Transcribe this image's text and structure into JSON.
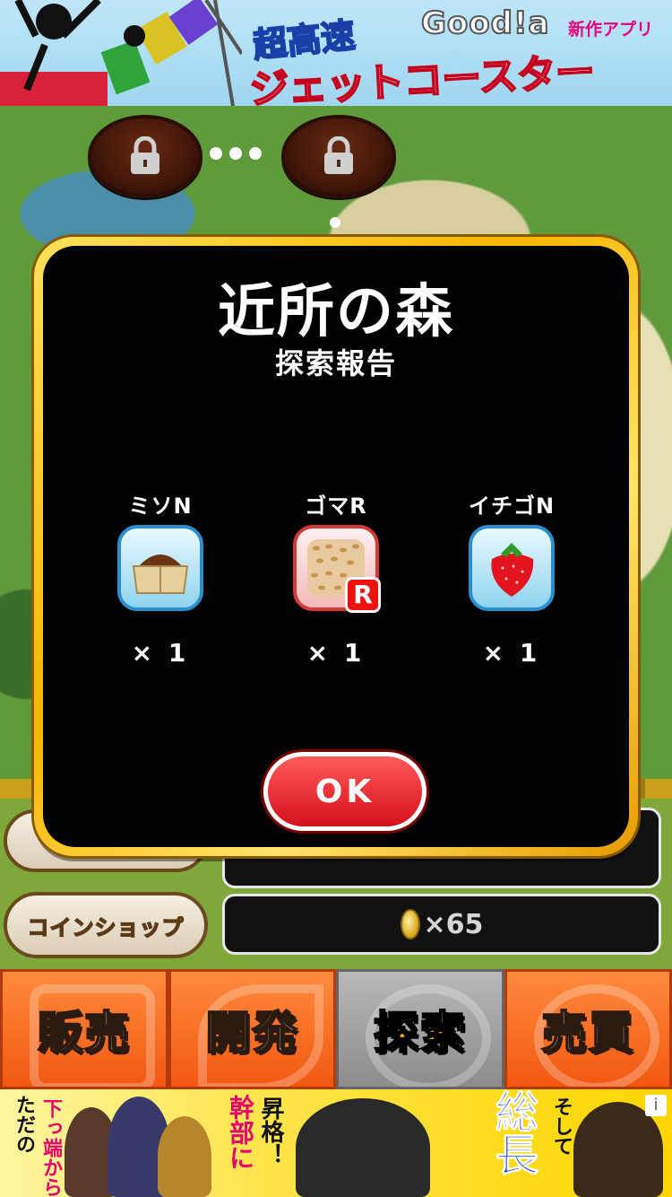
{
  "top_ad": {
    "title_line1": "超高速",
    "title_line2": "ジェットコースター",
    "brand": "Good!a",
    "tag": "新作アプリ"
  },
  "map": {
    "locks": [
      "lock-icon",
      "lock-icon"
    ]
  },
  "dialog": {
    "title": "近所の森",
    "subtitle": "探索報告",
    "items": [
      {
        "name": "ミソN",
        "icon": "miso-icon",
        "count": "× 1",
        "rare": false
      },
      {
        "name": "ゴマR",
        "icon": "sesame-icon",
        "count": "× 1",
        "rare": true,
        "badge": "R"
      },
      {
        "name": "イチゴN",
        "icon": "strawberry-icon",
        "count": "× 1",
        "rare": false
      }
    ],
    "ok_label": "OK"
  },
  "panel": {
    "coin_shop_label": "コインショップ",
    "coin_count": "×65"
  },
  "tabs": [
    {
      "label": "販売",
      "active": false
    },
    {
      "label": "開発",
      "active": false
    },
    {
      "label": "探索",
      "active": true
    },
    {
      "label": "売買",
      "active": false
    }
  ],
  "bottom_ad": {
    "text1": "ただの",
    "text2": "下っ端から",
    "text3": "幹部に",
    "text4": "昇格！",
    "text5": "総長",
    "text6": "そして",
    "info": "i"
  },
  "colors": {
    "tab_orange": "#f25812",
    "dialog_gold": "#f7b500",
    "ok_red": "#d6101a"
  }
}
